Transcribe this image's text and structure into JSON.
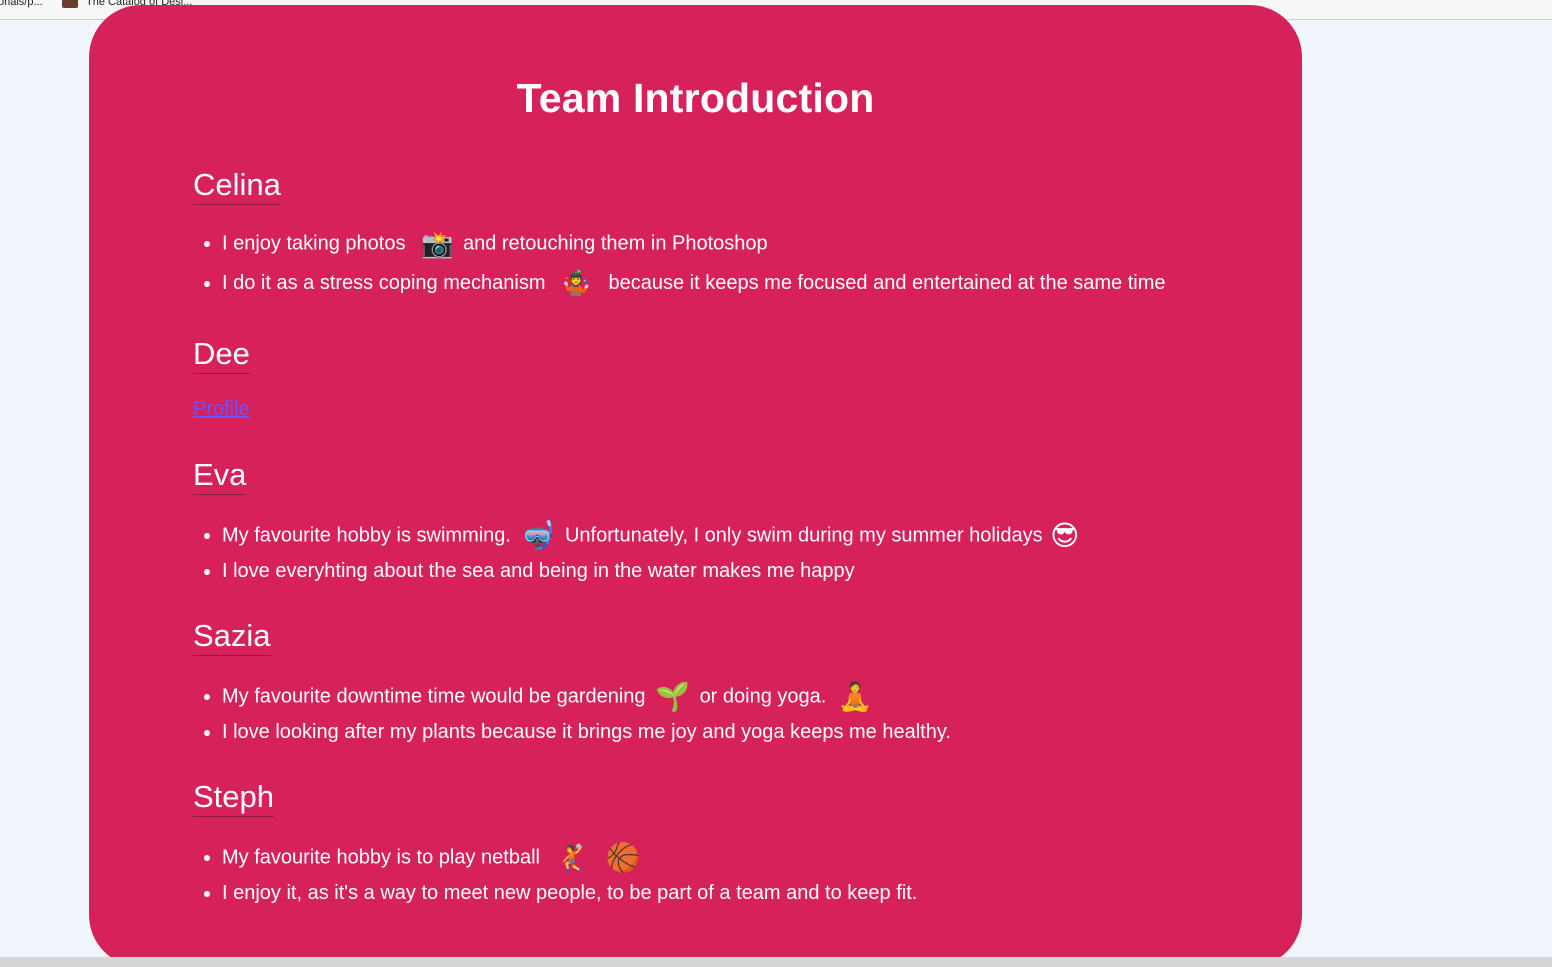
{
  "bookmarks": [
    {
      "label": "orials/p..."
    },
    {
      "label": "The Catalog of Desi..."
    }
  ],
  "page": {
    "title": "Team Introduction"
  },
  "members": [
    {
      "name": "Celina",
      "items": [
        {
          "before": "I enjoy taking photos",
          "emoji": "camera-with-flash-icon",
          "glyph": "📸",
          "after": "and retouching them in Photoshop"
        },
        {
          "before": "I do it as a stress coping mechanism",
          "emoji": "juggling-person-icon",
          "glyph": "🤹",
          "after": "because it keeps me focused and entertained at the same time"
        }
      ]
    },
    {
      "name": "Dee",
      "link": "Profile"
    },
    {
      "name": "Eva",
      "items": [
        {
          "before": "My favourite hobby is swimming.",
          "emoji": "diving-mask-icon",
          "glyph": "🤿",
          "after": "Unfortunately, I only swim during my summer holidays",
          "emoji2": "sun-with-sunglasses-icon",
          "glyph2": "😎"
        },
        {
          "before": "I love everyhting about the sea and being in the water makes me happy"
        }
      ]
    },
    {
      "name": "Sazia",
      "items": [
        {
          "before": "My favourite downtime time would be gardening",
          "emoji": "seedling-in-hands-icon",
          "glyph": "🌱",
          "after": "or doing yoga.",
          "emoji2": "lotus-position-icon",
          "glyph2": "🧘"
        },
        {
          "before": "I love looking after my plants because it brings me joy and yoga keeps me healthy."
        }
      ]
    },
    {
      "name": "Steph",
      "items": [
        {
          "before": "My favourite hobby is to play netball",
          "emoji": "person-throwing-ball-icon",
          "glyph": "🤾",
          "emoji2": "basketball-hoop-icon",
          "glyph2": "🏀"
        },
        {
          "before": "I enjoy it, as it's a way to meet new people, to be part of a team and to keep fit."
        }
      ]
    }
  ]
}
